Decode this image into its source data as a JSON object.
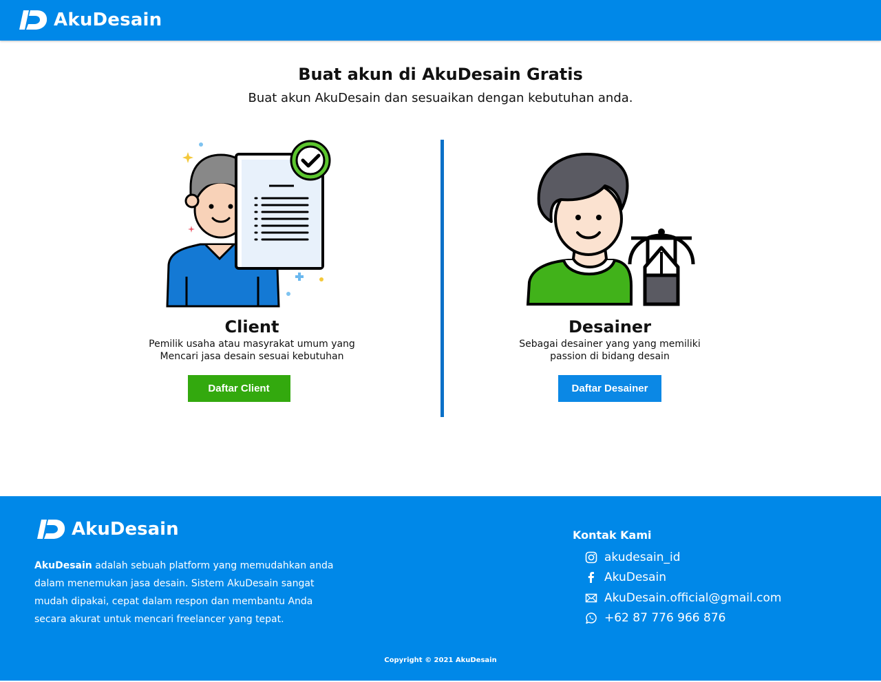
{
  "header": {
    "brand_name": "AkuDesain"
  },
  "hero": {
    "title": "Buat akun di AkuDesain Gratis",
    "subtitle": "Buat akun AkuDesain dan sesuaikan dengan kebutuhan anda."
  },
  "client_card": {
    "title": "Client",
    "desc_line1": "Pemilik usaha atau masyrakat umum yang",
    "desc_line2": "Mencari jasa desain sesuai kebutuhan",
    "button_label": "Daftar Client"
  },
  "designer_card": {
    "title": "Desainer",
    "desc_line1": "Sebagai desainer yang yang memiliki",
    "desc_line2": "passion di bidang desain",
    "button_label": "Daftar Desainer"
  },
  "footer": {
    "brand_name": "AkuDesain",
    "about_brand": "AkuDesain",
    "about_text": " adalah sebuah platform yang memudahkan anda dalam menemukan jasa desain.  Sistem AkuDesain sangat mudah dipakai, cepat dalam respon dan membantu Anda secara akurat untuk mencari freelancer yang tepat.",
    "contact_title": "Kontak Kami",
    "contacts": {
      "instagram": "akudesain_id",
      "facebook": "AkuDesain",
      "email": "AkuDesain.official@gmail.com",
      "whatsapp": "+62 87 776 966 876"
    },
    "copyright": "Copyright © 2021 AkuDesain"
  },
  "colors": {
    "primary_blue": "#0088e8",
    "client_button": "#33a90e",
    "designer_button": "#0b88e5",
    "divider": "#0a70c8"
  },
  "icons": [
    "akudesain-logo-icon",
    "instagram-icon",
    "facebook-icon",
    "mail-icon",
    "whatsapp-icon"
  ]
}
